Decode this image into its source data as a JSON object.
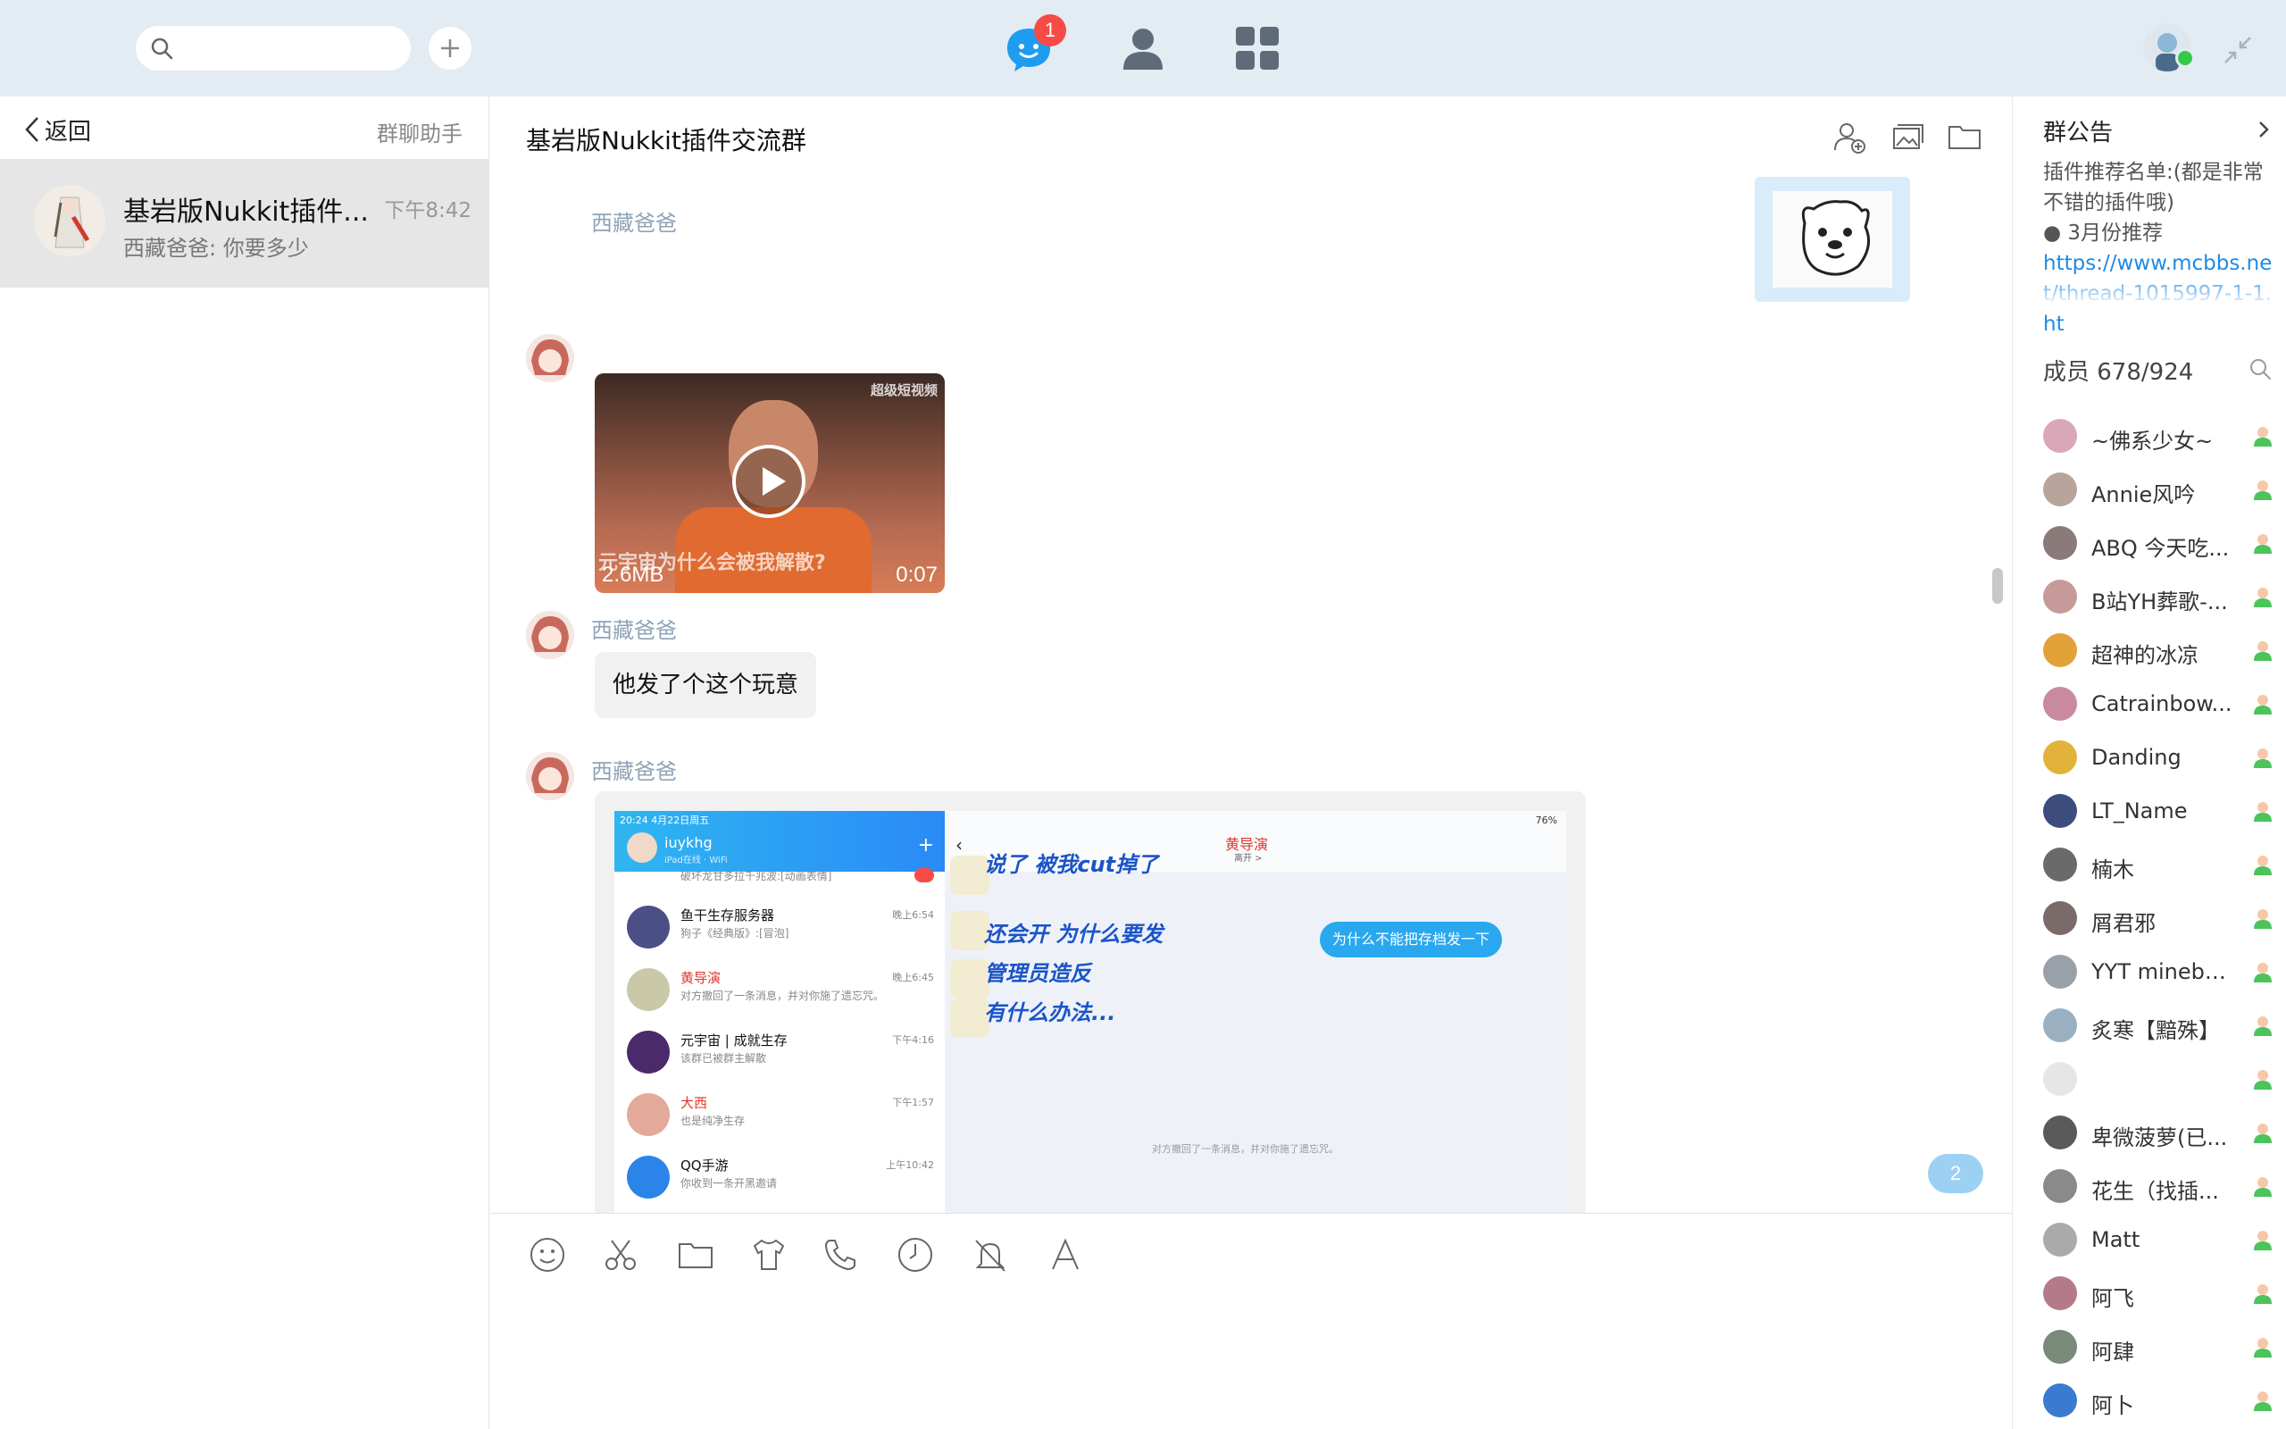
{
  "topbar": {
    "search_placeholder": "",
    "badge_count": "1"
  },
  "left": {
    "back_label": "返回",
    "assistant_label": "群聊助手",
    "conversation": {
      "name": "基岩版Nukkit插件...",
      "time": "下午8:42",
      "preview": "西藏爸爸: 你要多少"
    }
  },
  "chat": {
    "title": "基岩版Nukkit插件交流群",
    "messages": [
      {
        "sender": "西藏爸爸",
        "type": "video",
        "size": "2.6MB",
        "duration": "0:07",
        "caption": "元宇宙为什么会被我解散?",
        "watermark": "超级短视频"
      },
      {
        "sender": "西藏爸爸",
        "type": "text",
        "text": "他发了个这个玩意"
      },
      {
        "sender": "西藏爸爸",
        "type": "image"
      }
    ],
    "new_count": "2"
  },
  "screenshot": {
    "status_time": "20:24  4月22日周五",
    "user": "iuykhg",
    "user_status": "iPad在线 · WiFi",
    "items": [
      {
        "name": "",
        "preview": "破坏龙甘多拉千兆波:[动画表情]",
        "time": ""
      },
      {
        "name": "鱼干生存服务器",
        "preview": "狗子《经典版》:[冒泡]",
        "time": "晚上6:54"
      },
      {
        "name": "黄导演",
        "preview": "对方撤回了一条消息，并对你施了遗忘咒。",
        "time": "晚上6:45"
      },
      {
        "name": "元宇宙 | 成就生存",
        "preview": "该群已被群主解散",
        "time": "下午4:16"
      },
      {
        "name": "大西",
        "preview": "也是纯净生存",
        "time": "下午1:57"
      },
      {
        "name": "QQ手游",
        "preview": "你收到一条开黑邀请",
        "time": "上午10:42"
      }
    ],
    "contact": "黄导演",
    "contact_status": "离开 >",
    "battery": "76%",
    "messages": [
      "说了 被我cut掉了",
      "还会开 为什么要发",
      "管理员造反",
      "有什么办法..."
    ],
    "mine": "为什么不能把存档发一下",
    "notice": "对方撤回了一条消息，并对你施了遗忘咒。"
  },
  "right": {
    "notice_title": "群公告",
    "notice_text": "插件推荐名单:(都是非常不错的插件哦)",
    "notice_bullet": "● 3月份推荐",
    "notice_link": "https://www.mcbbs.net/thread-1015997-1-1.ht",
    "members_label": "成员 678/924",
    "members": [
      {
        "name": "~佛系少女~",
        "color": "#d9a7b8"
      },
      {
        "name": "Annie风吟",
        "color": "#b9a49c"
      },
      {
        "name": "ABQ 今天吃...",
        "color": "#8a7a7a"
      },
      {
        "name": "B站YH葬歌-...",
        "color": "#c79a9a"
      },
      {
        "name": "超神的冰凉",
        "color": "#e3a13a"
      },
      {
        "name": "Catrainbow...",
        "color": "#c98aa0"
      },
      {
        "name": "Danding",
        "color": "#e2b23a"
      },
      {
        "name": "LT_Name",
        "color": "#3c4c7c"
      },
      {
        "name": "楠木",
        "color": "#6a6a6a"
      },
      {
        "name": "屑君邪",
        "color": "#7a6a6a"
      },
      {
        "name": "YYT minebb...",
        "color": "#9aa0a8"
      },
      {
        "name": "炙寒【黯殊】",
        "color": "#9ab0c0"
      },
      {
        "name": "",
        "color": "#e6e6e6"
      },
      {
        "name": "卑微菠萝(已...",
        "color": "#5a5a5a"
      },
      {
        "name": "花生（找插...",
        "color": "#8a8a8a"
      },
      {
        "name": "Matt",
        "color": "#aaaaaa"
      },
      {
        "name": "阿飞",
        "color": "#b47a8a"
      },
      {
        "name": "阿肆",
        "color": "#7a8a7a"
      },
      {
        "name": "阿卜",
        "color": "#3a7ad0"
      }
    ]
  }
}
